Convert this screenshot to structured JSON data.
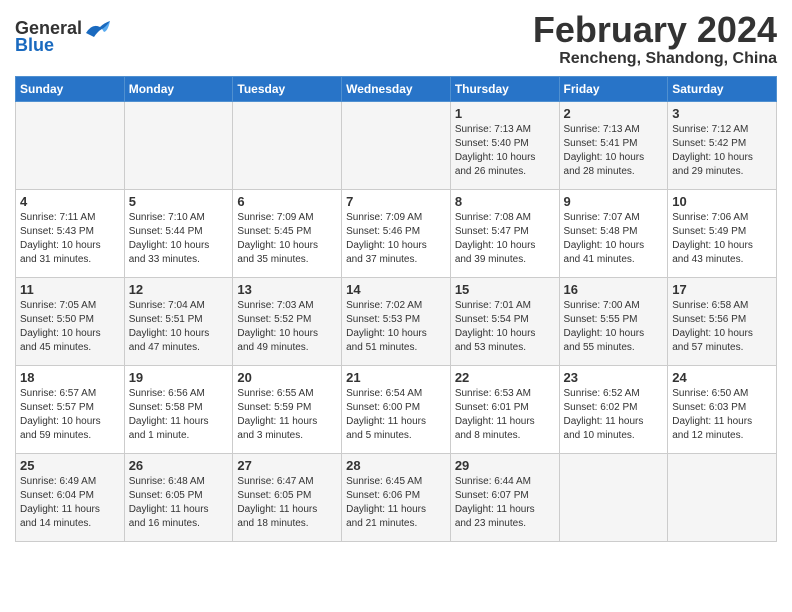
{
  "logo": {
    "general": "General",
    "blue": "Blue"
  },
  "title": {
    "month": "February 2024",
    "location": "Rencheng, Shandong, China"
  },
  "headers": [
    "Sunday",
    "Monday",
    "Tuesday",
    "Wednesday",
    "Thursday",
    "Friday",
    "Saturday"
  ],
  "weeks": [
    [
      {
        "day": "",
        "info": ""
      },
      {
        "day": "",
        "info": ""
      },
      {
        "day": "",
        "info": ""
      },
      {
        "day": "",
        "info": ""
      },
      {
        "day": "1",
        "info": "Sunrise: 7:13 AM\nSunset: 5:40 PM\nDaylight: 10 hours\nand 26 minutes."
      },
      {
        "day": "2",
        "info": "Sunrise: 7:13 AM\nSunset: 5:41 PM\nDaylight: 10 hours\nand 28 minutes."
      },
      {
        "day": "3",
        "info": "Sunrise: 7:12 AM\nSunset: 5:42 PM\nDaylight: 10 hours\nand 29 minutes."
      }
    ],
    [
      {
        "day": "4",
        "info": "Sunrise: 7:11 AM\nSunset: 5:43 PM\nDaylight: 10 hours\nand 31 minutes."
      },
      {
        "day": "5",
        "info": "Sunrise: 7:10 AM\nSunset: 5:44 PM\nDaylight: 10 hours\nand 33 minutes."
      },
      {
        "day": "6",
        "info": "Sunrise: 7:09 AM\nSunset: 5:45 PM\nDaylight: 10 hours\nand 35 minutes."
      },
      {
        "day": "7",
        "info": "Sunrise: 7:09 AM\nSunset: 5:46 PM\nDaylight: 10 hours\nand 37 minutes."
      },
      {
        "day": "8",
        "info": "Sunrise: 7:08 AM\nSunset: 5:47 PM\nDaylight: 10 hours\nand 39 minutes."
      },
      {
        "day": "9",
        "info": "Sunrise: 7:07 AM\nSunset: 5:48 PM\nDaylight: 10 hours\nand 41 minutes."
      },
      {
        "day": "10",
        "info": "Sunrise: 7:06 AM\nSunset: 5:49 PM\nDaylight: 10 hours\nand 43 minutes."
      }
    ],
    [
      {
        "day": "11",
        "info": "Sunrise: 7:05 AM\nSunset: 5:50 PM\nDaylight: 10 hours\nand 45 minutes."
      },
      {
        "day": "12",
        "info": "Sunrise: 7:04 AM\nSunset: 5:51 PM\nDaylight: 10 hours\nand 47 minutes."
      },
      {
        "day": "13",
        "info": "Sunrise: 7:03 AM\nSunset: 5:52 PM\nDaylight: 10 hours\nand 49 minutes."
      },
      {
        "day": "14",
        "info": "Sunrise: 7:02 AM\nSunset: 5:53 PM\nDaylight: 10 hours\nand 51 minutes."
      },
      {
        "day": "15",
        "info": "Sunrise: 7:01 AM\nSunset: 5:54 PM\nDaylight: 10 hours\nand 53 minutes."
      },
      {
        "day": "16",
        "info": "Sunrise: 7:00 AM\nSunset: 5:55 PM\nDaylight: 10 hours\nand 55 minutes."
      },
      {
        "day": "17",
        "info": "Sunrise: 6:58 AM\nSunset: 5:56 PM\nDaylight: 10 hours\nand 57 minutes."
      }
    ],
    [
      {
        "day": "18",
        "info": "Sunrise: 6:57 AM\nSunset: 5:57 PM\nDaylight: 10 hours\nand 59 minutes."
      },
      {
        "day": "19",
        "info": "Sunrise: 6:56 AM\nSunset: 5:58 PM\nDaylight: 11 hours\nand 1 minute."
      },
      {
        "day": "20",
        "info": "Sunrise: 6:55 AM\nSunset: 5:59 PM\nDaylight: 11 hours\nand 3 minutes."
      },
      {
        "day": "21",
        "info": "Sunrise: 6:54 AM\nSunset: 6:00 PM\nDaylight: 11 hours\nand 5 minutes."
      },
      {
        "day": "22",
        "info": "Sunrise: 6:53 AM\nSunset: 6:01 PM\nDaylight: 11 hours\nand 8 minutes."
      },
      {
        "day": "23",
        "info": "Sunrise: 6:52 AM\nSunset: 6:02 PM\nDaylight: 11 hours\nand 10 minutes."
      },
      {
        "day": "24",
        "info": "Sunrise: 6:50 AM\nSunset: 6:03 PM\nDaylight: 11 hours\nand 12 minutes."
      }
    ],
    [
      {
        "day": "25",
        "info": "Sunrise: 6:49 AM\nSunset: 6:04 PM\nDaylight: 11 hours\nand 14 minutes."
      },
      {
        "day": "26",
        "info": "Sunrise: 6:48 AM\nSunset: 6:05 PM\nDaylight: 11 hours\nand 16 minutes."
      },
      {
        "day": "27",
        "info": "Sunrise: 6:47 AM\nSunset: 6:05 PM\nDaylight: 11 hours\nand 18 minutes."
      },
      {
        "day": "28",
        "info": "Sunrise: 6:45 AM\nSunset: 6:06 PM\nDaylight: 11 hours\nand 21 minutes."
      },
      {
        "day": "29",
        "info": "Sunrise: 6:44 AM\nSunset: 6:07 PM\nDaylight: 11 hours\nand 23 minutes."
      },
      {
        "day": "",
        "info": ""
      },
      {
        "day": "",
        "info": ""
      }
    ]
  ]
}
